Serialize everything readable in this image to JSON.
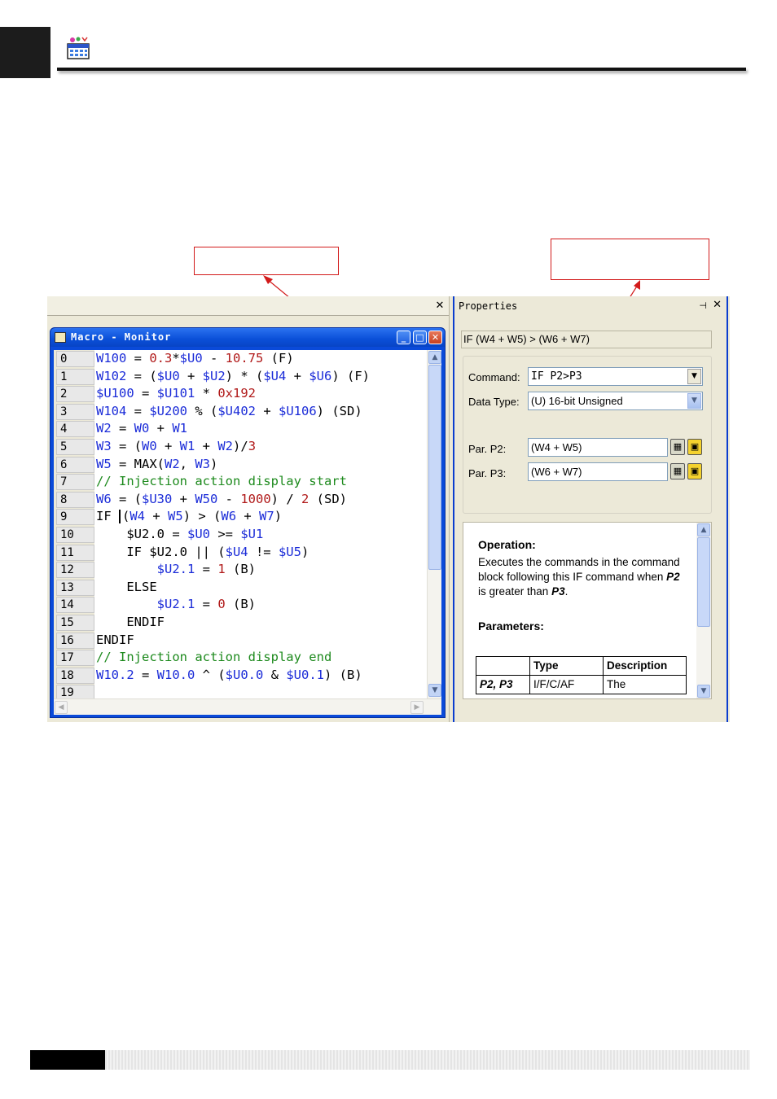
{
  "left_pane": {
    "close_glyph": "✕"
  },
  "macro_window": {
    "title": "Macro - Monitor",
    "min_glyph": "_",
    "max_glyph": "□",
    "close_glyph": "✕",
    "lines": [
      {
        "num": "0",
        "tokens": [
          [
            "W100",
            "b"
          ],
          [
            " = ",
            "k"
          ],
          [
            "0.3",
            "r"
          ],
          [
            "*",
            "k"
          ],
          [
            "$U0",
            "b"
          ],
          [
            " - ",
            "k"
          ],
          [
            "10.75",
            "r"
          ],
          [
            " (F)",
            "k"
          ]
        ]
      },
      {
        "num": "1",
        "tokens": [
          [
            "W102",
            "b"
          ],
          [
            " = (",
            "k"
          ],
          [
            "$U0",
            "b"
          ],
          [
            " + ",
            "k"
          ],
          [
            "$U2",
            "b"
          ],
          [
            ") * (",
            "k"
          ],
          [
            "$U4",
            "b"
          ],
          [
            " + ",
            "k"
          ],
          [
            "$U6",
            "b"
          ],
          [
            ") (F)",
            "k"
          ]
        ]
      },
      {
        "num": "2",
        "tokens": [
          [
            "$U100",
            "b"
          ],
          [
            " = ",
            "k"
          ],
          [
            "$U101",
            "b"
          ],
          [
            " * ",
            "k"
          ],
          [
            "0x192",
            "r"
          ]
        ]
      },
      {
        "num": "3",
        "tokens": [
          [
            "W104",
            "b"
          ],
          [
            " = ",
            "k"
          ],
          [
            "$U200",
            "b"
          ],
          [
            " % (",
            "k"
          ],
          [
            "$U402",
            "b"
          ],
          [
            " + ",
            "k"
          ],
          [
            "$U106",
            "b"
          ],
          [
            ") (SD)",
            "k"
          ]
        ]
      },
      {
        "num": "4",
        "tokens": [
          [
            "W2",
            "b"
          ],
          [
            " = ",
            "k"
          ],
          [
            "W0",
            "b"
          ],
          [
            " + ",
            "k"
          ],
          [
            "W1",
            "b"
          ]
        ]
      },
      {
        "num": "5",
        "tokens": [
          [
            "W3",
            "b"
          ],
          [
            " = (",
            "k"
          ],
          [
            "W0",
            "b"
          ],
          [
            " + ",
            "k"
          ],
          [
            "W1",
            "b"
          ],
          [
            " + ",
            "k"
          ],
          [
            "W2",
            "b"
          ],
          [
            ")/",
            "k"
          ],
          [
            "3",
            "r"
          ]
        ]
      },
      {
        "num": "6",
        "tokens": [
          [
            "W5",
            "b"
          ],
          [
            " = MAX(",
            "k"
          ],
          [
            "W2",
            "b"
          ],
          [
            ", ",
            "k"
          ],
          [
            "W3",
            "b"
          ],
          [
            ")",
            "k"
          ]
        ]
      },
      {
        "num": "7",
        "tokens": [
          [
            "// Injection action display start",
            "g"
          ]
        ]
      },
      {
        "num": "8",
        "tokens": [
          [
            "W6",
            "b"
          ],
          [
            " = (",
            "k"
          ],
          [
            "$U30",
            "b"
          ],
          [
            " + ",
            "k"
          ],
          [
            "W50",
            "b"
          ],
          [
            " - ",
            "k"
          ],
          [
            "1000",
            "r"
          ],
          [
            ") / ",
            "k"
          ],
          [
            "2",
            "r"
          ],
          [
            " (SD)",
            "k"
          ]
        ]
      },
      {
        "num": "9",
        "tokens": [
          [
            "IF ",
            "k"
          ],
          [
            "|",
            "caret"
          ],
          [
            "(",
            "k"
          ],
          [
            "W4",
            "b"
          ],
          [
            " + ",
            "k"
          ],
          [
            "W5",
            "b"
          ],
          [
            ") > (",
            "k"
          ],
          [
            "W6",
            "b"
          ],
          [
            " + ",
            "k"
          ],
          [
            "W7",
            "b"
          ],
          [
            ")",
            "k"
          ]
        ]
      },
      {
        "num": "10",
        "tokens": [
          [
            "    $U2.0 = ",
            "k"
          ],
          [
            "$U0",
            "b"
          ],
          [
            " >= ",
            "k"
          ],
          [
            "$U1",
            "b"
          ]
        ]
      },
      {
        "num": "11",
        "tokens": [
          [
            "    IF $U2.0 || (",
            "k"
          ],
          [
            "$U4",
            "b"
          ],
          [
            " != ",
            "k"
          ],
          [
            "$U5",
            "b"
          ],
          [
            ")",
            "k"
          ]
        ]
      },
      {
        "num": "12",
        "tokens": [
          [
            "        ",
            "k"
          ],
          [
            "$U2.1",
            "b"
          ],
          [
            " = ",
            "k"
          ],
          [
            "1",
            "r"
          ],
          [
            " (B)",
            "k"
          ]
        ]
      },
      {
        "num": "13",
        "tokens": [
          [
            "    ELSE",
            "k"
          ]
        ]
      },
      {
        "num": "14",
        "tokens": [
          [
            "        ",
            "k"
          ],
          [
            "$U2.1",
            "b"
          ],
          [
            " = ",
            "k"
          ],
          [
            "0",
            "r"
          ],
          [
            " (B)",
            "k"
          ]
        ]
      },
      {
        "num": "15",
        "tokens": [
          [
            "    ENDIF",
            "k"
          ]
        ]
      },
      {
        "num": "16",
        "tokens": [
          [
            "ENDIF",
            "k"
          ]
        ]
      },
      {
        "num": "17",
        "tokens": [
          [
            "// Injection action display end",
            "g"
          ]
        ]
      },
      {
        "num": "18",
        "tokens": [
          [
            "W10.2",
            "b"
          ],
          [
            " = ",
            "k"
          ],
          [
            "W10.0",
            "b"
          ],
          [
            " ^ (",
            "k"
          ],
          [
            "$U0.0",
            "b"
          ],
          [
            " & ",
            "k"
          ],
          [
            "$U0.1",
            "b"
          ],
          [
            ") (B)",
            "k"
          ]
        ]
      },
      {
        "num": "19",
        "tokens": []
      }
    ]
  },
  "properties": {
    "title": "Properties",
    "pin_glyph": "⊣",
    "close_glyph": "✕",
    "expression": "IF (W4 + W5) > (W6 + W7)",
    "command_label": "Command:",
    "command_value": "IF P2>P3",
    "datatype_label": "Data Type:",
    "datatype_value": "(U) 16-bit Unsigned",
    "p2_label": "Par. P2:",
    "p2_value": "(W4 + W5)",
    "p3_label": "Par. P3:",
    "p3_value": "(W6 + W7)",
    "help": {
      "operation_heading": "Operation:",
      "operation_text_1": "Executes the commands in the command block  following this IF command when ",
      "operation_p2": "P2",
      "operation_text_2": " is greater than ",
      "operation_p3": "P3",
      "operation_text_3": ".",
      "parameters_heading": "Parameters:",
      "table_headers": [
        "",
        "Type",
        "Description"
      ],
      "table_row": [
        "P2, P3",
        "I/F/C/AF",
        "The"
      ]
    }
  },
  "colors": {
    "keyword_blue": "#1a2bd8",
    "number_red": "#b01818",
    "comment_green": "#1d8a1d",
    "title_blue": "#0a4ad9"
  }
}
